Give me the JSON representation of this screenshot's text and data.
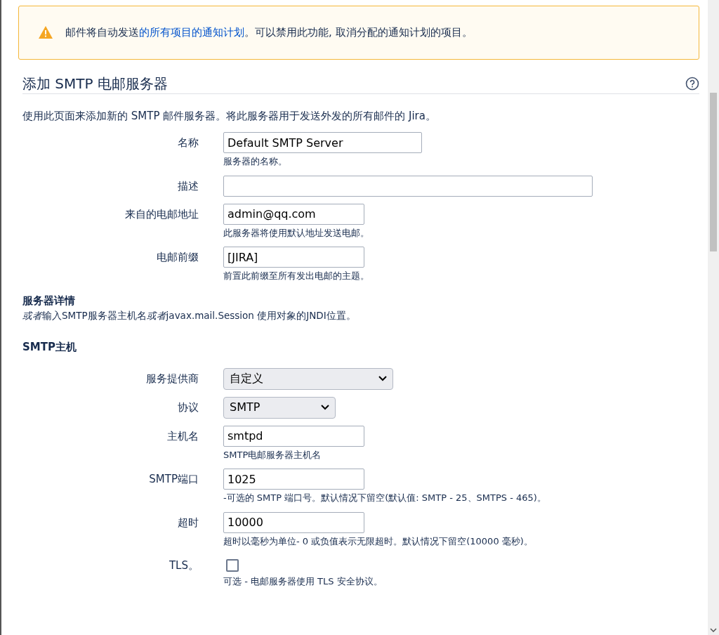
{
  "alert": {
    "before": "邮件将自动发送",
    "link": "的所有项目的通知计划",
    "after": "。可以禁用此功能, 取消分配的通知计划的项目。"
  },
  "title": "添加 SMTP 电邮服务器",
  "intro": "使用此页面来添加新的 SMTP 邮件服务器。将此服务器用于发送外发的所有邮件的 Jira。",
  "fields": [
    {
      "kind": "text",
      "label": "名称",
      "value": "Default SMTP Server",
      "help": "服务器的名称。"
    },
    {
      "kind": "text",
      "label": "描述"
    },
    {
      "kind": "text",
      "label": "来自的电邮地址",
      "value": "admin@qq.com",
      "help": "此服务器将使用默认地址发送电邮。"
    },
    {
      "kind": "text",
      "label": "电邮前缀",
      "value": "[JIRA]",
      "help": "前置此前缀至所有发出电邮的主题。"
    }
  ],
  "server_details": {
    "heading": "服务器详情",
    "description": [
      {
        "text": "或者",
        "italic": true
      },
      {
        "text": "输入SMTP服务器主机名",
        "italic": false
      },
      {
        "text": "或者",
        "italic": true
      },
      {
        "text": "javax.mail.Session 使用对象的JNDI位置。",
        "italic": false
      }
    ]
  },
  "smtp_host": {
    "heading": "SMTP主机",
    "fields": [
      {
        "kind": "select",
        "label": "服务提供商",
        "value": "自定义"
      },
      {
        "kind": "select",
        "label": "协议",
        "value": "SMTP"
      },
      {
        "kind": "text",
        "label": "主机名",
        "value": "smtpd",
        "help": "SMTP电邮服务器主机名"
      },
      {
        "kind": "text",
        "label": "SMTP端口",
        "value": "1025",
        "help": "-可选的 SMTP 端口号。默认情况下留空(默认值: SMTP - 25、SMTPS - 465)。"
      },
      {
        "kind": "text",
        "label": "超时",
        "value": "10000",
        "help": "超时以毫秒为单位- 0 或负值表示无限超时。默认情况下留空(10000 毫秒)。"
      },
      {
        "kind": "checkbox",
        "label": "TLS。",
        "checked": false,
        "help": "可选 - 电邮服务器使用 TLS 安全协议。"
      }
    ]
  }
}
